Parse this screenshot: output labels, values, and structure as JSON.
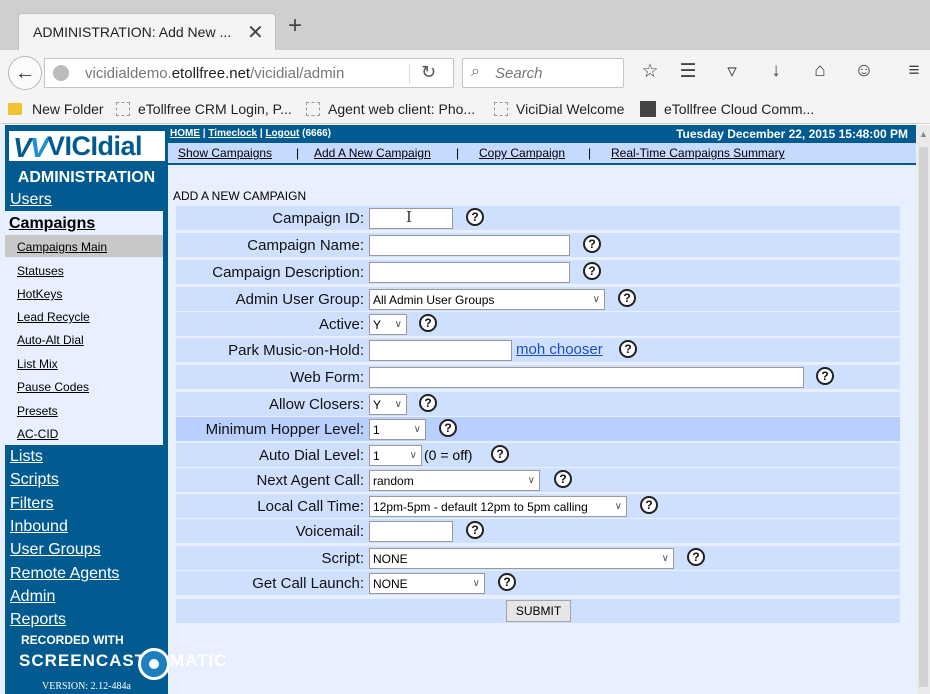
{
  "browser": {
    "tab_title": "ADMINISTRATION: Add New ...",
    "tab_close": "✕",
    "new_tab": "+",
    "url_domain": "vicidialdemo.",
    "url_host": "etollfree.net",
    "url_path": "/vicidial/admin",
    "search_placeholder": "Search",
    "bookmarks": [
      "New Folder",
      "eTollfree CRM Login, P...",
      "Agent web client: Pho...",
      "ViciDial Welcome",
      "eTollfree Cloud Comm..."
    ]
  },
  "header": {
    "links": [
      "HOME",
      "Timeclock",
      "Logout"
    ],
    "user": "(6666)",
    "datetime": "Tuesday December 22, 2015 15:48:00 PM"
  },
  "subnav": {
    "items": [
      "Show Campaigns",
      "Add A New Campaign",
      "Copy Campaign",
      "Real-Time Campaigns Summary"
    ]
  },
  "sidebar": {
    "logo_text": "VICIdial",
    "section_title": "ADMINISTRATION",
    "users": "Users",
    "campaigns": "Campaigns",
    "campaign_sub": [
      "Campaigns Main",
      "Statuses",
      "HotKeys",
      "Lead Recycle",
      "Auto-Alt Dial",
      "List Mix",
      "Pause Codes",
      "Presets",
      "AC-CID"
    ],
    "links": [
      "Lists",
      "Scripts",
      "Filters",
      "Inbound",
      "User Groups",
      "Remote Agents",
      "Admin",
      "Reports"
    ],
    "version": "VERSION: 2.12-484a"
  },
  "watermark": {
    "line1": "RECORDED WITH",
    "line2a": "SCREENCAST",
    "line2b": "MATIC"
  },
  "form": {
    "title": "ADD A NEW CAMPAIGN",
    "fields": {
      "campaign_id": {
        "label": "Campaign ID:",
        "value": ""
      },
      "campaign_name": {
        "label": "Campaign Name:",
        "value": ""
      },
      "campaign_description": {
        "label": "Campaign Description:",
        "value": ""
      },
      "admin_user_group": {
        "label": "Admin User Group:",
        "value": "All Admin User Groups"
      },
      "active": {
        "label": "Active:",
        "value": "Y"
      },
      "park_music": {
        "label": "Park Music-on-Hold:",
        "value": "",
        "link": "moh chooser"
      },
      "web_form": {
        "label": "Web Form:",
        "value": ""
      },
      "allow_closers": {
        "label": "Allow Closers:",
        "value": "Y"
      },
      "min_hopper": {
        "label": "Minimum Hopper Level:",
        "value": "1"
      },
      "auto_dial": {
        "label": "Auto Dial Level:",
        "value": "1",
        "note": "(0 = off)"
      },
      "next_agent_call": {
        "label": "Next Agent Call:",
        "value": "random"
      },
      "local_call_time": {
        "label": "Local Call Time:",
        "value": "12pm-5pm - default 12pm to 5pm calling"
      },
      "voicemail": {
        "label": "Voicemail:",
        "value": ""
      },
      "script": {
        "label": "Script:",
        "value": "NONE"
      },
      "get_call_launch": {
        "label": "Get Call Launch:",
        "value": "NONE"
      }
    },
    "help_glyph": "?",
    "submit_label": "SUBMIT"
  }
}
